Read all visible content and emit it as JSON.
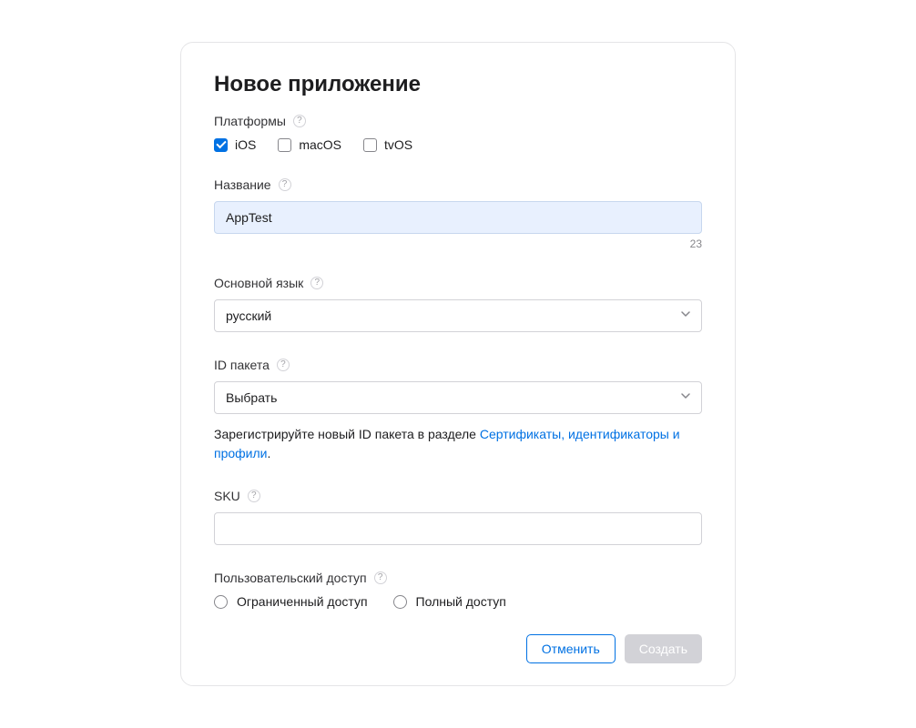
{
  "modal": {
    "title": "Новое приложение"
  },
  "platforms": {
    "label": "Платформы",
    "options": [
      {
        "label": "iOS",
        "checked": true
      },
      {
        "label": "macOS",
        "checked": false
      },
      {
        "label": "tvOS",
        "checked": false
      }
    ]
  },
  "name": {
    "label": "Название",
    "value": "AppTest",
    "char_count": "23"
  },
  "language": {
    "label": "Основной язык",
    "selected": "русский"
  },
  "bundle": {
    "label": "ID пакета",
    "selected": "Выбрать",
    "helper_prefix": "Зарегистрируйте новый ID пакета в разделе ",
    "helper_link": "Сертификаты, идентификаторы и профили",
    "helper_suffix": "."
  },
  "sku": {
    "label": "SKU",
    "value": ""
  },
  "access": {
    "label": "Пользовательский доступ",
    "options": [
      {
        "label": "Ограниченный доступ"
      },
      {
        "label": "Полный доступ"
      }
    ]
  },
  "footer": {
    "cancel": "Отменить",
    "create": "Создать"
  }
}
